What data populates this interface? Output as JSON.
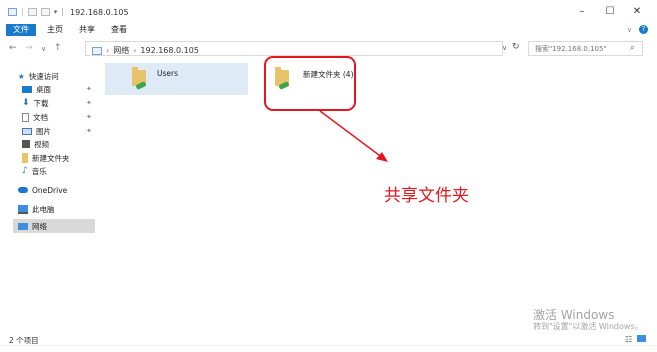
{
  "window": {
    "title": "192.168.0.105",
    "minimize": "–",
    "maximize": "☐",
    "close": "✕"
  },
  "ribbon": {
    "tabs": [
      "文件",
      "主页",
      "共享",
      "查看"
    ]
  },
  "address": {
    "segments": [
      "网络",
      "192.168.0.105"
    ],
    "separator": "›"
  },
  "search": {
    "placeholder": "搜索\"192.168.0.105\""
  },
  "sidebar": {
    "quick_access": "快速访问",
    "items": [
      "桌面",
      "下载",
      "文档",
      "图片",
      "视频",
      "新建文件夹",
      "音乐"
    ],
    "onedrive": "OneDrive",
    "this_pc": "此电脑",
    "network": "网络"
  },
  "content": {
    "folders": [
      "Users",
      "新建文件夹 (4)"
    ]
  },
  "annotation": {
    "text": "共享文件夹",
    "color": "#e2181f"
  },
  "watermark": {
    "line1": "激活 Windows",
    "line2": "转到\"设置\"以激活 Windows。"
  },
  "status": {
    "count": "2 个项目"
  },
  "colors": {
    "accent": "#1979ca",
    "selection": "#dfeaf7"
  }
}
